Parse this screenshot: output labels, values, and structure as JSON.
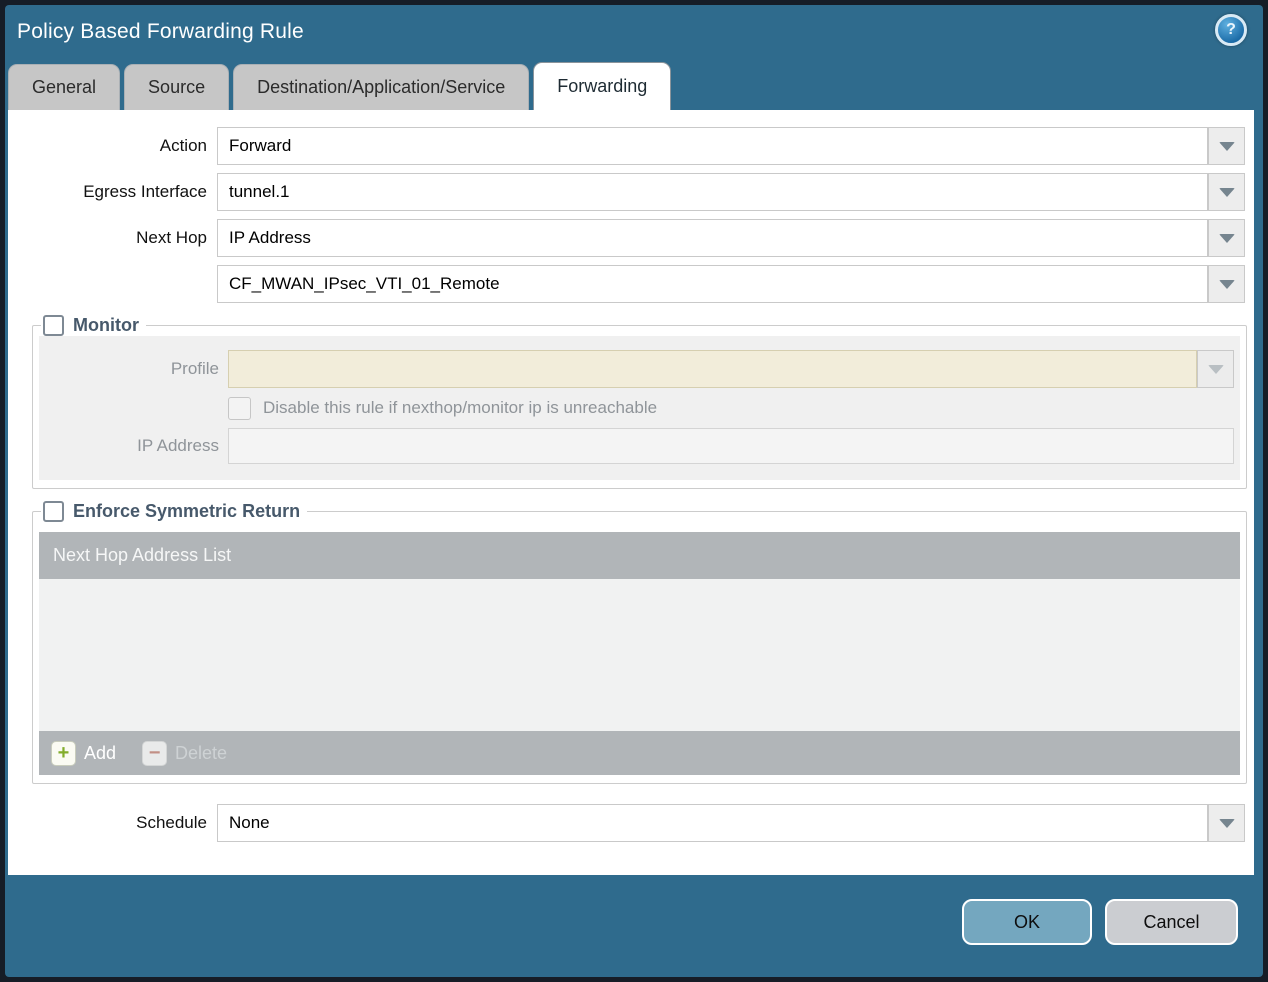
{
  "dialog": {
    "title": "Policy Based Forwarding Rule"
  },
  "icons": {
    "help_glyph": "?",
    "add_glyph": "+",
    "delete_glyph": "−"
  },
  "tabs": [
    {
      "label": "General",
      "active": false
    },
    {
      "label": "Source",
      "active": false
    },
    {
      "label": "Destination/Application/Service",
      "active": false
    },
    {
      "label": "Forwarding",
      "active": true
    }
  ],
  "form": {
    "action": {
      "label": "Action",
      "value": "Forward"
    },
    "egress_interface": {
      "label": "Egress Interface",
      "value": "tunnel.1"
    },
    "next_hop": {
      "label": "Next Hop",
      "value": "IP Address"
    },
    "next_hop_address": {
      "value": "CF_MWAN_IPsec_VTI_01_Remote"
    },
    "schedule": {
      "label": "Schedule",
      "value": "None"
    }
  },
  "monitor": {
    "label": "Monitor",
    "checked": false,
    "profile": {
      "label": "Profile",
      "value": "",
      "disabled": true
    },
    "disable_rule": {
      "label": "Disable this rule if nexthop/monitor ip is unreachable",
      "checked": false,
      "disabled": true
    },
    "ip_address": {
      "label": "IP Address",
      "value": "",
      "disabled": true
    }
  },
  "symmetric_return": {
    "label": "Enforce Symmetric Return",
    "checked": false,
    "table": {
      "header": "Next Hop Address List",
      "rows": []
    },
    "add_label": "Add",
    "delete_label": "Delete",
    "delete_disabled": true
  },
  "footer": {
    "ok_label": "OK",
    "cancel_label": "Cancel"
  },
  "colors": {
    "chrome_teal": "#2f6b8d",
    "outer_border": "#161d27",
    "tab_inactive": "#c6c6c6",
    "tab_active": "#ffffff",
    "group_title": "#47596b",
    "panel_gray": "#f0f0f0",
    "disabled_field_cream": "#f2edda",
    "table_header_gray": "#b1b5b8",
    "table_body_gray": "#f1f2f2",
    "ok_button": "#74a7bf",
    "cancel_button": "#cbcdd1",
    "add_plus_green": "#83ad2b",
    "delete_minus_red": "#c28f85"
  }
}
